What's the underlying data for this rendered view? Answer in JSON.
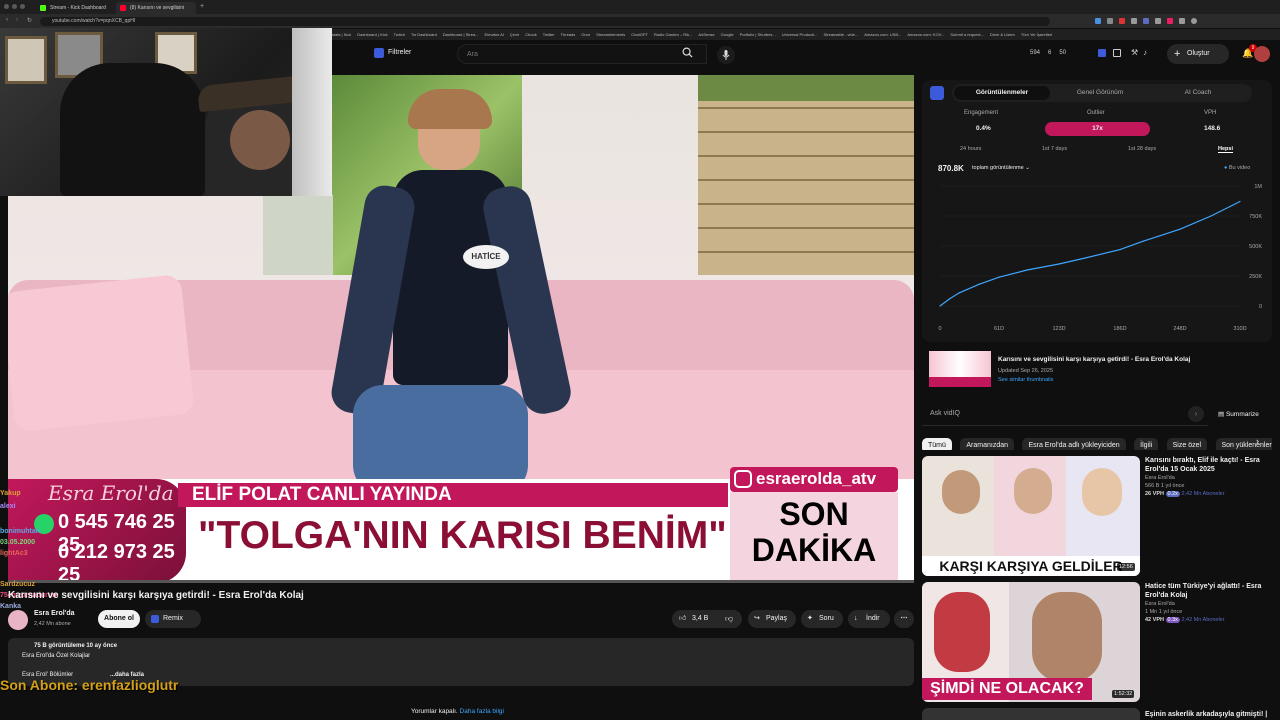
{
  "browser": {
    "tabs": [
      {
        "label": "Stream - Kick Dashboard",
        "color": "#53fc18"
      },
      {
        "label": "(8) Karısını ve sevgilisini karşı",
        "color": "#ff0033"
      }
    ],
    "url": "youtube.com/watch?v=pqnXCB_qpHI",
    "bookmarks": [
      "stats | Kick",
      "Dashboard | Kick",
      "Twitch",
      "Tw Dashboard",
      "Dashboard | Strea...",
      "Elevator AI",
      "Çevir",
      "Cbook",
      "Twitter",
      "Threads",
      "Onur",
      "Streamelements",
      "ChatGPT",
      "Radio Garden – Rik...",
      "AdSense",
      "Google",
      "Portfolio | Shutters...",
      "Universal Producti...",
      "Streamable - vide...",
      "Amazon.com: USB...",
      "Amazon.com: KOV...",
      "Submit a request...",
      "Drive & Listen",
      "Tüm Yer İşaretleri"
    ]
  },
  "header": {
    "filters_label": "Filtreler",
    "search_placeholder": "Ara",
    "stats": [
      "594",
      "6",
      "50"
    ],
    "create_label": "Oluştur",
    "notif_badge": "9"
  },
  "overlay": {
    "chat_names": [
      "Yakup",
      "alexi",
      "bonimuhtari",
      "03.05.2000",
      "lightAc3",
      "Sardzucuz",
      "75cmzurnadurum",
      "Kanka"
    ],
    "sub_label": "Son Abone: erenfazlioglutr"
  },
  "video": {
    "tv_logo": "Esra Erol'da",
    "phone1": "0 545 746 25 25",
    "phone2": "0 212 973 25 25",
    "banner_top": "ELİF POLAT CANLI YAYINDA",
    "banner_main": "\"TOLGA'NIN KARISI BENİM\"",
    "insta": "esraerolda_atv",
    "son_dakika_1": "SON",
    "son_dakika_2": "DAKİKA",
    "name_tag": "HATİCE"
  },
  "meta": {
    "title": "Karısını ve sevgilisini karşı karşıya getirdi! - Esra Erol'da Kolaj",
    "channel": "Esra Erol'da",
    "subs": "2,42 Mn abone",
    "subscribe": "Abone ol",
    "remix": "Remix",
    "likes": "3,4 B",
    "share": "Paylaş",
    "ask": "Soru",
    "download": "İndir",
    "desc_line1": "75 B görüntüleme  10 ay önce",
    "desc_line2": "Esra Erol'da Özel Kolajlar",
    "desc_line3": "Esra Erol' Bölümler",
    "more": "...daha fazla",
    "comments": "Yorumlar kapalı.",
    "comments_link": "Daha fazla bilgi"
  },
  "vidiq": {
    "tabs": [
      "Görüntülenmeler",
      "Genel Görünüm",
      "AI Coach"
    ],
    "metric_labels": [
      "Engagement",
      "Outlier",
      "VPH"
    ],
    "metric_values": [
      "0.4%",
      "17x",
      "148.6"
    ],
    "ranges": [
      "24 hours",
      "1st 7 days",
      "1st 28 days",
      "Hepsi"
    ],
    "total": "870.8K",
    "total_label": "toplam görüntülenme",
    "legend": "Bu video",
    "ask": "Ask vidIQ",
    "summarize": "Summarize",
    "thumb_title": "Karısını ve sevgilisini karşı karşıya getirdi! - Esra Erol'da Kolaj",
    "thumb_updated": "Updated Sep 26, 2025",
    "thumb_link": "See similar thumbnails"
  },
  "chart_data": {
    "type": "line",
    "x_ticks": [
      "0",
      "61D",
      "123D",
      "186D",
      "248D",
      "310D"
    ],
    "y_ticks": [
      "1M",
      "750K",
      "500K",
      "250K",
      "0"
    ],
    "x": [
      0,
      10,
      20,
      40,
      61,
      90,
      123,
      150,
      186,
      210,
      248,
      280,
      300,
      310
    ],
    "y": [
      0,
      60000,
      110000,
      180000,
      240000,
      300000,
      350000,
      400000,
      470000,
      540000,
      640000,
      750000,
      830000,
      870800
    ],
    "ylim": [
      0,
      1000000
    ],
    "xlim": [
      0,
      310
    ],
    "color": "#3ea6ff"
  },
  "filters": [
    "Tümü",
    "Aramanızdan",
    "Esra Erol'da adlı yükleyiciden",
    "İlgili",
    "Size özel",
    "Son yüklenenler"
  ],
  "recs": [
    {
      "title": "Karısını bıraktı, Elif ile kaçtı! - Esra Erol'da 15 Ocak 2025",
      "channel": "Esra Erol'da",
      "views": "566 B  1 yıl önce",
      "vph": "26 VPH",
      "ratio": "0.2x",
      "subs": "2,42 Mn Aboneler",
      "duration": "12:56",
      "caption": "KARŞI KARŞIYA GELDİLER"
    },
    {
      "title": "Hatice tüm Türkiye'yi ağlattı! - Esra Erol'da Kolaj",
      "channel": "Esra Erol'da",
      "views": "1 Mn  1 yıl önce",
      "vph": "42 VPH",
      "ratio": "0.3x",
      "subs": "2,42 Mn Aboneler",
      "duration": "1:52:32",
      "caption": "ŞİMDİ NE OLACAK?"
    },
    {
      "title": "Eşinin askerlik arkadaşıyla gitmişti! |"
    }
  ],
  "colors": {
    "accent": "#ff0033",
    "vidiq_pink": "#c2185b",
    "banner": "#c2185b",
    "sub_yellow": "#d4a017"
  }
}
